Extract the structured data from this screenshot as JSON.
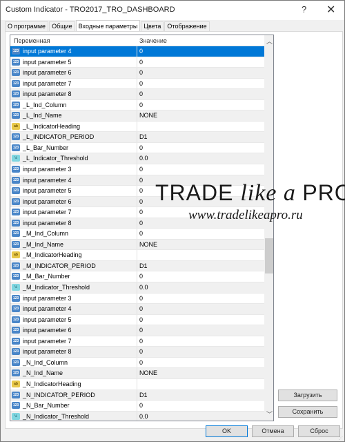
{
  "window": {
    "title": "Custom Indicator - TRO2017_TRO_DASHBOARD",
    "help": "?",
    "close": "✕"
  },
  "tabs": [
    {
      "label": "О программе",
      "active": false
    },
    {
      "label": "Общие",
      "active": false
    },
    {
      "label": "Входные параметры",
      "active": true
    },
    {
      "label": "Цвета",
      "active": false
    },
    {
      "label": "Отображение",
      "active": false
    }
  ],
  "table": {
    "headers": {
      "name": "Переменная",
      "value": "Значение"
    },
    "rows": [
      {
        "type": "int",
        "name": "input parameter 4",
        "value": "0",
        "selected": true
      },
      {
        "type": "int",
        "name": "input parameter 5",
        "value": "0"
      },
      {
        "type": "int",
        "name": "input parameter 6",
        "value": "0"
      },
      {
        "type": "int",
        "name": "input parameter 7",
        "value": "0"
      },
      {
        "type": "int",
        "name": "input parameter 8",
        "value": "0"
      },
      {
        "type": "int",
        "name": "_L_Ind_Column",
        "value": "0"
      },
      {
        "type": "int",
        "name": "_L_Ind_Name",
        "value": "NONE"
      },
      {
        "type": "string",
        "name": "_L_IndicatorHeading",
        "value": ""
      },
      {
        "type": "int",
        "name": "_L_INDICATOR_PERIOD",
        "value": "D1"
      },
      {
        "type": "int",
        "name": "_L_Bar_Number",
        "value": "0"
      },
      {
        "type": "double",
        "name": "_L_Indicator_Threshold",
        "value": "0.0"
      },
      {
        "type": "int",
        "name": "input parameter 3",
        "value": "0"
      },
      {
        "type": "int",
        "name": "input parameter 4",
        "value": "0"
      },
      {
        "type": "int",
        "name": "input parameter 5",
        "value": "0"
      },
      {
        "type": "int",
        "name": "input parameter 6",
        "value": "0"
      },
      {
        "type": "int",
        "name": "input parameter 7",
        "value": "0"
      },
      {
        "type": "int",
        "name": "input parameter 8",
        "value": "0"
      },
      {
        "type": "int",
        "name": "_M_Ind_Column",
        "value": "0"
      },
      {
        "type": "int",
        "name": "_M_Ind_Name",
        "value": "NONE"
      },
      {
        "type": "string",
        "name": "_M_IndicatorHeading",
        "value": ""
      },
      {
        "type": "int",
        "name": "_M_INDICATOR_PERIOD",
        "value": "D1"
      },
      {
        "type": "int",
        "name": "_M_Bar_Number",
        "value": "0"
      },
      {
        "type": "double",
        "name": "_M_Indicator_Threshold",
        "value": "0.0"
      },
      {
        "type": "int",
        "name": "input parameter 3",
        "value": "0"
      },
      {
        "type": "int",
        "name": "input parameter 4",
        "value": "0"
      },
      {
        "type": "int",
        "name": "input parameter 5",
        "value": "0"
      },
      {
        "type": "int",
        "name": "input parameter 6",
        "value": "0"
      },
      {
        "type": "int",
        "name": "input parameter 7",
        "value": "0"
      },
      {
        "type": "int",
        "name": "input parameter 8",
        "value": "0"
      },
      {
        "type": "int",
        "name": "_N_Ind_Column",
        "value": "0"
      },
      {
        "type": "int",
        "name": "_N_Ind_Name",
        "value": "NONE"
      },
      {
        "type": "string",
        "name": "_N_IndicatorHeading",
        "value": ""
      },
      {
        "type": "int",
        "name": "_N_INDICATOR_PERIOD",
        "value": "D1"
      },
      {
        "type": "int",
        "name": "_N_Bar_Number",
        "value": "0"
      },
      {
        "type": "double",
        "name": "_N_Indicator_Threshold",
        "value": "0.0"
      }
    ],
    "icon_text": {
      "int": "123",
      "string": "ab",
      "double": "½"
    }
  },
  "buttons": {
    "load": "Загрузить",
    "save": "Сохранить",
    "ok": "OK",
    "cancel": "Отмена",
    "reset": "Сброс"
  },
  "watermark": {
    "line1_a": "TRADE ",
    "line1_b": "like a ",
    "line1_c": "PRO",
    "line2": "www.tradelikeapro.ru"
  },
  "colors": {
    "selection": "#0078d7"
  }
}
